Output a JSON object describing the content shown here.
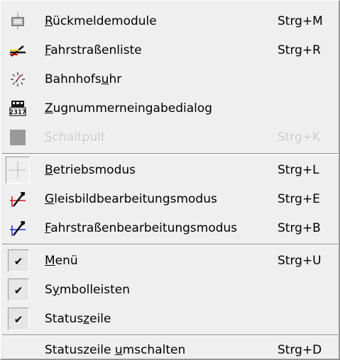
{
  "menu": {
    "items": [
      {
        "pre": "",
        "ul": "R",
        "post": "ückmeldemodule",
        "shortcut": "Strg+M"
      },
      {
        "pre": "",
        "ul": "F",
        "post": "ahrstraßenliste",
        "shortcut": "Strg+R"
      },
      {
        "pre": "Bahnhofs",
        "ul": "u",
        "post": "hr",
        "shortcut": ""
      },
      {
        "pre": "",
        "ul": "Z",
        "post": "ugnummerneingabedialog",
        "shortcut": ""
      },
      {
        "pre": "",
        "ul": "S",
        "post": "chaltpult",
        "shortcut": "Strg+K"
      },
      {
        "pre": "",
        "ul": "B",
        "post": "etriebsmodus",
        "shortcut": "Strg+L"
      },
      {
        "pre": "",
        "ul": "G",
        "post": "leisbildbearbeitungsmodus",
        "shortcut": "Strg+E"
      },
      {
        "pre": "",
        "ul": "F",
        "post": "ahrstraßenbearbeitungsmodus",
        "shortcut": "Strg+B"
      },
      {
        "pre": "",
        "ul": "M",
        "post": "enü",
        "shortcut": "Strg+U"
      },
      {
        "pre": "S",
        "ul": "y",
        "post": "mbolleisten",
        "shortcut": ""
      },
      {
        "pre": "Status",
        "ul": "z",
        "post": "eile",
        "shortcut": ""
      },
      {
        "pre": "Statuszeile ",
        "ul": "u",
        "post": "mschalten",
        "shortcut": "Strg+D"
      }
    ],
    "checkmark": "✔",
    "disabled_item": "Schaltpult",
    "checked_items": [
      "Menü",
      "Symbolleisten",
      "Statuszeile"
    ],
    "icon_names": [
      "feedback-module-icon",
      "route-list-icon",
      "station-clock-icon",
      "train-number-icon",
      "control-panel-icon",
      "operation-mode-icon",
      "track-edit-mode-icon",
      "route-edit-mode-icon"
    ],
    "icon_badge": "2317"
  }
}
